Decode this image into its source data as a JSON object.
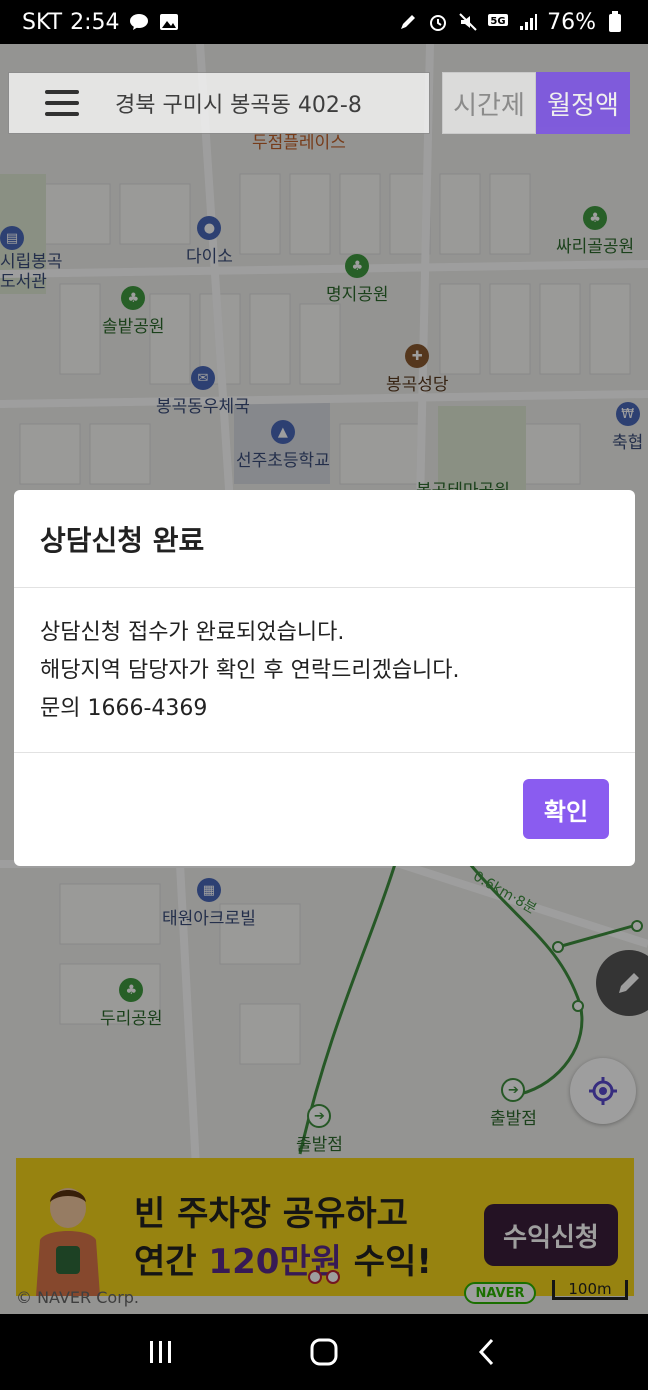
{
  "status_bar": {
    "carrier": "SKT",
    "time": "2:54",
    "battery": "76%",
    "left_icons": [
      "talk-icon",
      "gallery-icon"
    ],
    "right_icons": [
      "pen-icon",
      "alarm-icon",
      "mute-icon",
      "5g-icon",
      "signal-icon",
      "battery-icon"
    ]
  },
  "search": {
    "address": "경북 구미시 봉곡동 402-8"
  },
  "mode_tabs": [
    {
      "label": "시간제",
      "selected": false
    },
    {
      "label": "월정액",
      "selected": true
    }
  ],
  "map": {
    "pois": [
      {
        "name": "다이소",
        "kind": "blue"
      },
      {
        "name": "명지공원",
        "kind": "green"
      },
      {
        "name": "솔밭공원",
        "kind": "green"
      },
      {
        "name": "싸리골공원",
        "kind": "green"
      },
      {
        "name": "봉곡성당",
        "kind": "brown"
      },
      {
        "name": "봉곡동우체국",
        "kind": "blue"
      },
      {
        "name": "선주초등학교",
        "kind": "blue"
      },
      {
        "name": "시립봉곡\n도서관",
        "kind": "blue"
      },
      {
        "name": "축협",
        "kind": "blue"
      },
      {
        "name": "태원아크로빌",
        "kind": "blue"
      },
      {
        "name": "두리공원",
        "kind": "green"
      },
      {
        "name": "출발점",
        "kind": "green"
      },
      {
        "name": "출발점",
        "kind": "green"
      }
    ],
    "partial_labels": [
      "두점플레이스",
      "봉곡테마공원"
    ],
    "trail_label": "0.6km·8분",
    "copyright": "© NAVER Corp.",
    "naver_badge": "NAVER",
    "scale": "100m"
  },
  "ad": {
    "line1": "빈 주차장 공유하고",
    "line2_prefix": "연간 ",
    "line2_highlight": "120만원",
    "line2_suffix": " 수익!",
    "button": "수익신청"
  },
  "dialog": {
    "title": "상담신청 완료",
    "lines": [
      "상담신청 접수가 완료되었습니다.",
      "해당지역 담당자가 확인 후 연락드리겠습니다.",
      "문의 1666-4369"
    ],
    "ok_label": "확인"
  },
  "colors": {
    "accent": "#8a5cf0",
    "tab_selected": "#7c52e8",
    "ad_bg": "#f4d31a",
    "ad_button": "#3b1e3a"
  }
}
